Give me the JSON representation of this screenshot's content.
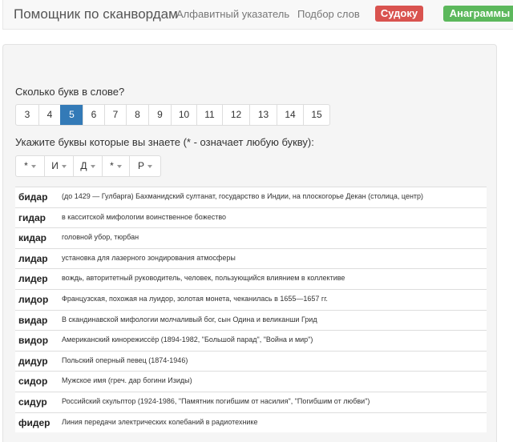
{
  "navbar": {
    "brand": "Помощник по сканвордам",
    "links": [
      "Алфавитный указатель",
      "Подбор слов"
    ],
    "buttons": {
      "sudoku": "Судоку",
      "anagrams": "Анаграммы"
    }
  },
  "length_selector": {
    "label": "Сколько букв в слове?",
    "options": [
      "3",
      "4",
      "5",
      "6",
      "7",
      "8",
      "9",
      "10",
      "11",
      "12",
      "13",
      "14",
      "15"
    ],
    "selected": "5"
  },
  "letters_selector": {
    "label": "Укажите буквы которые вы знаете (* - означает любую букву):",
    "letters": [
      "*",
      "И",
      "Д",
      "*",
      "Р"
    ]
  },
  "results": [
    {
      "word": "бидар",
      "definition": "(до 1429 — Гулбарга) Бахманидский султанат, государство в Индии, на плоскогорье Декан (столица, центр)"
    },
    {
      "word": "гидар",
      "definition": "в касситской мифологии воинственное божество"
    },
    {
      "word": "кидар",
      "definition": "головной убор, тюрбан"
    },
    {
      "word": "лидар",
      "definition": "установка для лазерного зондирования атмосферы"
    },
    {
      "word": "лидер",
      "definition": "вождь, авторитетный руководитель, человек, пользующийся влиянием в коллективе"
    },
    {
      "word": "лидор",
      "definition": "Французская, похожая на луидор, золотая монета, чеканилась в 1655—1657 гг."
    },
    {
      "word": "видар",
      "definition": "В скандинавской мифологии молчаливый бог, сын Одина и великанши Грид"
    },
    {
      "word": "видор",
      "definition": "Американский кинорежиссёр (1894-1982, \"Большой парад\", \"Война и мир\")"
    },
    {
      "word": "дидур",
      "definition": "Польский оперный певец (1874-1946)"
    },
    {
      "word": "сидор",
      "definition": "Мужское имя (греч. дар богини Изиды)"
    },
    {
      "word": "сидур",
      "definition": "Российский скульптор (1924-1986, \"Памятник погибшим от насилия\", \"Погибшим от любви\")"
    },
    {
      "word": "фидер",
      "definition": "Линия передачи электрических колебаний в радиотехнике"
    }
  ]
}
